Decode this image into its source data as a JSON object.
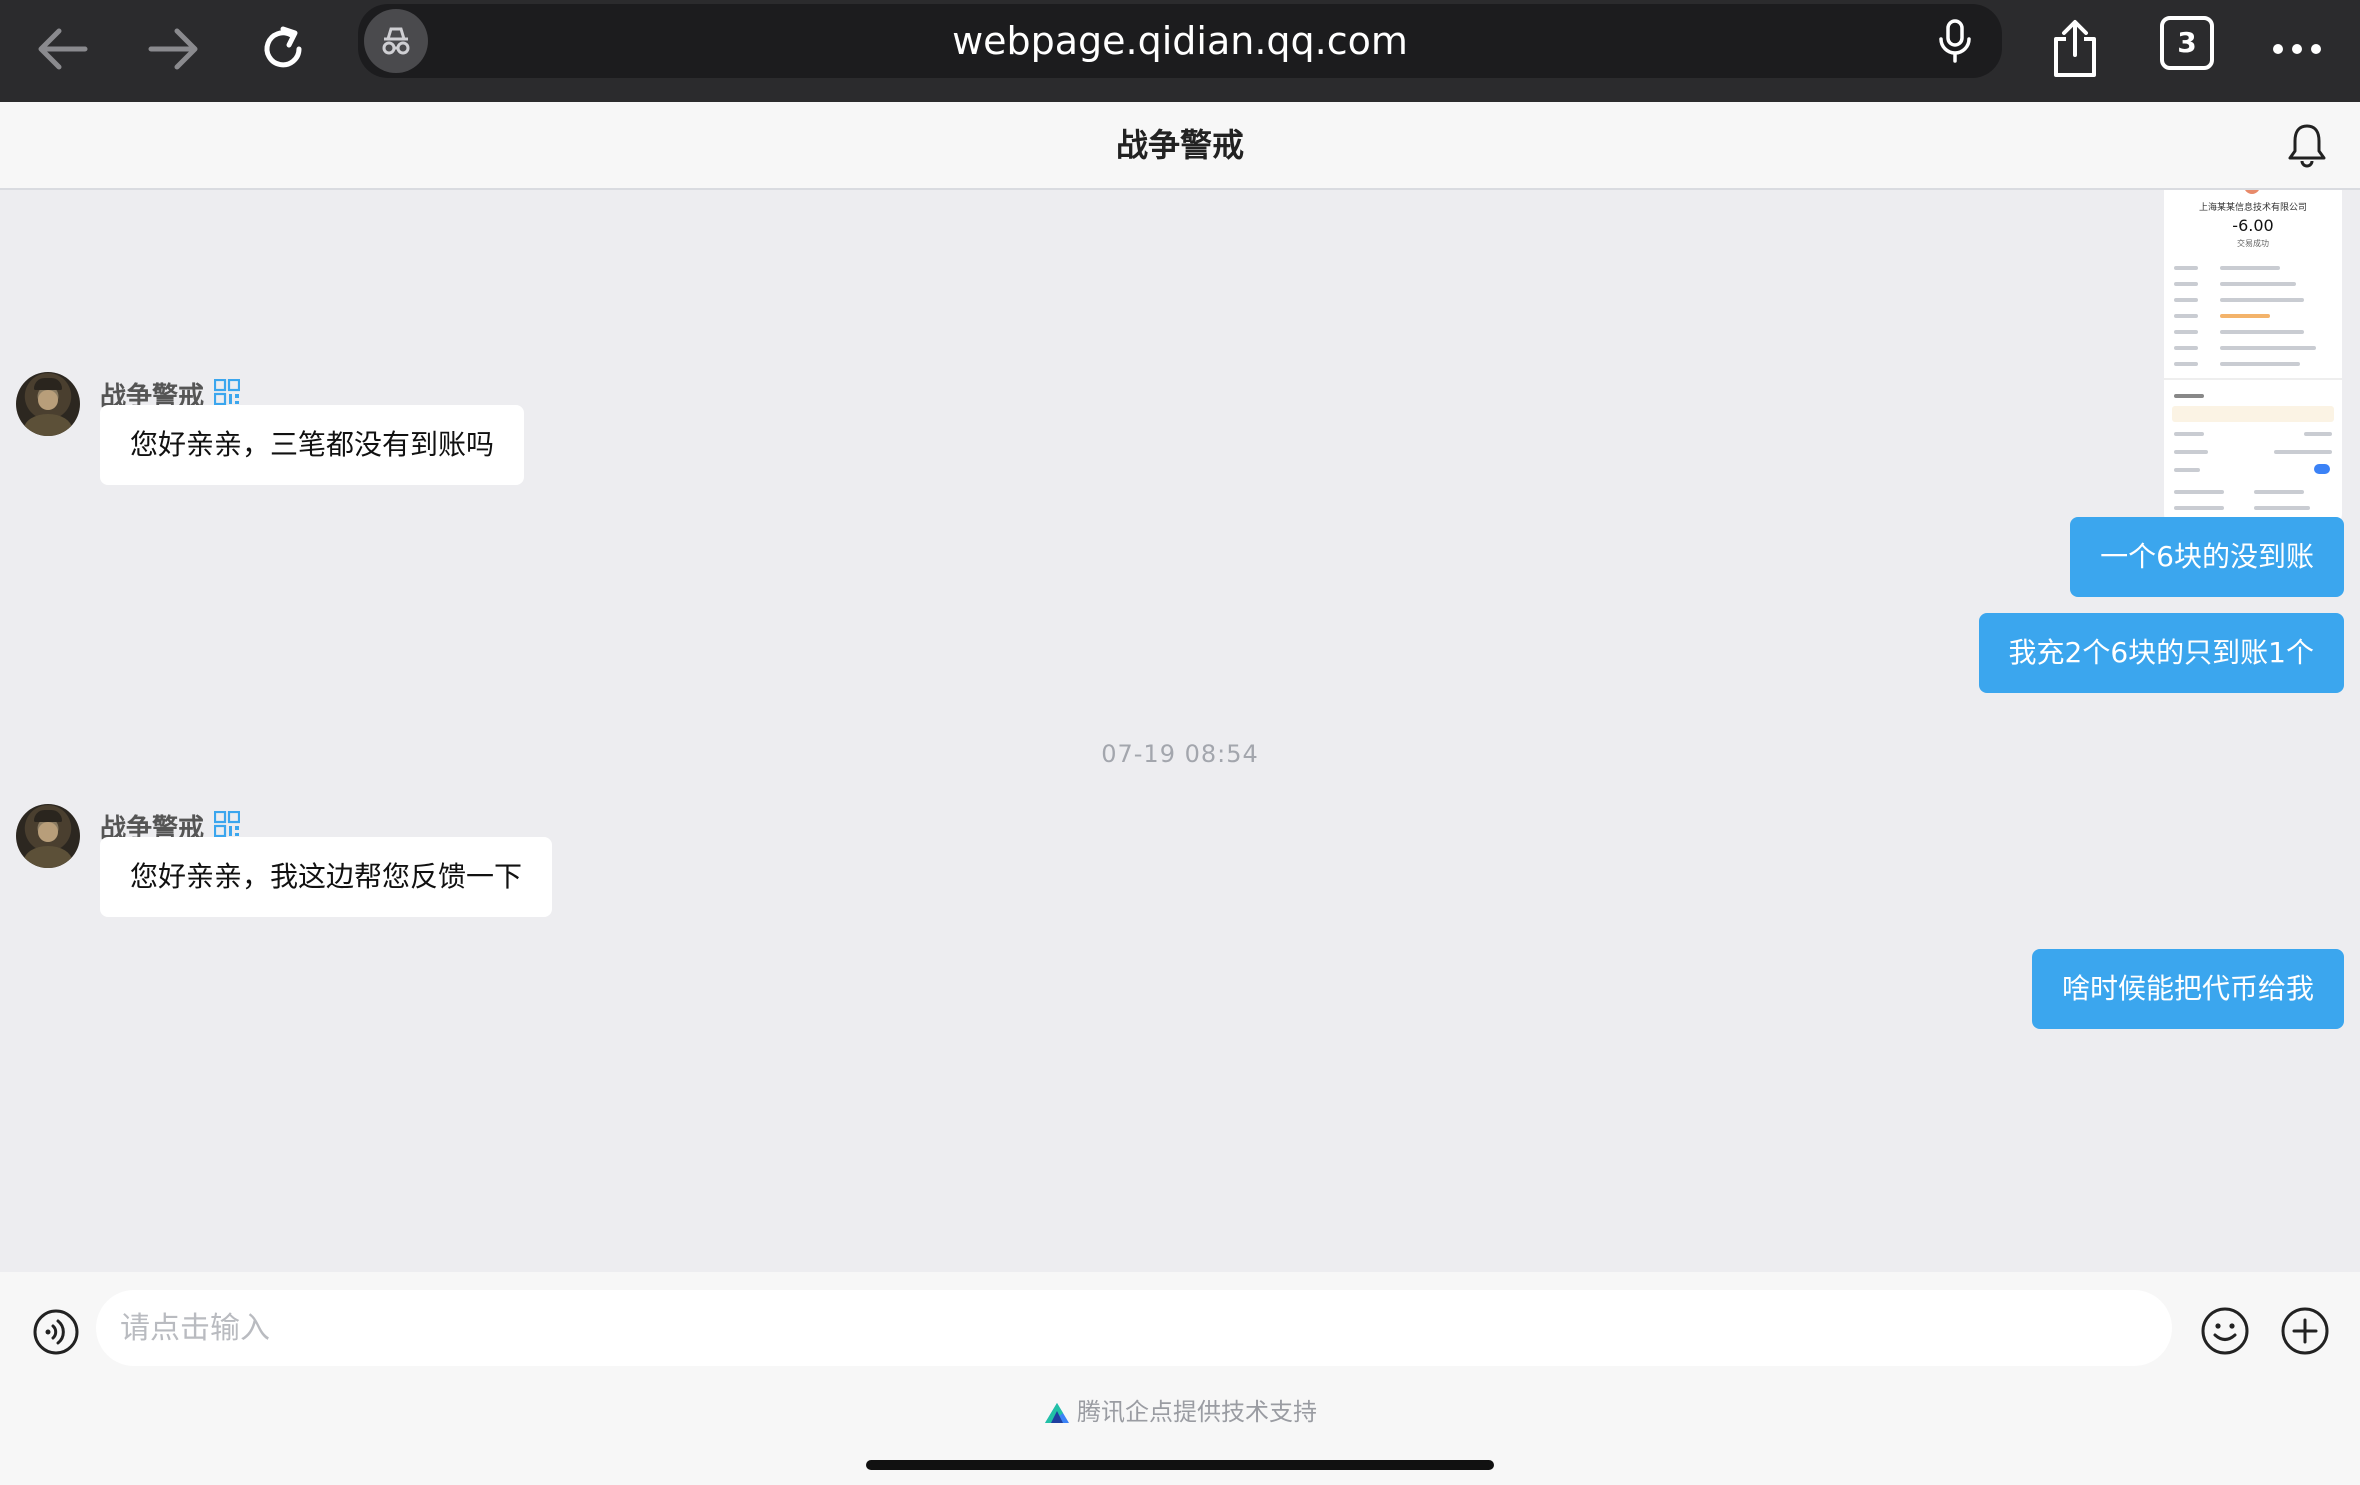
{
  "browser": {
    "url": "webpage.qidian.qq.com",
    "tabs_count": "3",
    "icons": [
      "back-arrow-icon",
      "forward-arrow-icon",
      "reload-icon",
      "private-browsing-icon",
      "microphone-icon",
      "share-icon",
      "tabs-icon",
      "more-icon"
    ]
  },
  "header": {
    "title": "战争警戒"
  },
  "receipt": {
    "merchant": "上海某某信息技术有限公司",
    "amount": "-6.00",
    "status": "交易成功"
  },
  "messages": [
    {
      "type": "incoming",
      "sender": "战争警戒",
      "text": "您好亲亲，三笔都没有到账吗"
    },
    {
      "type": "outgoing",
      "text": "一个6块的没到账"
    },
    {
      "type": "outgoing",
      "text": "我充2个6块的只到账1个"
    },
    {
      "type": "timestamp",
      "text": "07-19 08:54"
    },
    {
      "type": "incoming",
      "sender": "战争警戒",
      "text": "您好亲亲，我这边帮您反馈一下"
    },
    {
      "type": "outgoing",
      "text": "啥时候能把代币给我"
    }
  ],
  "input": {
    "placeholder": "请点击输入"
  },
  "footer": {
    "powered_by": "腾讯企点提供技术支持"
  },
  "colors": {
    "outgoing_bubble": "#3ba6ee",
    "incoming_bubble": "#ffffff",
    "chat_background": "#ededf0",
    "browser_bar": "#2b2b2d"
  }
}
